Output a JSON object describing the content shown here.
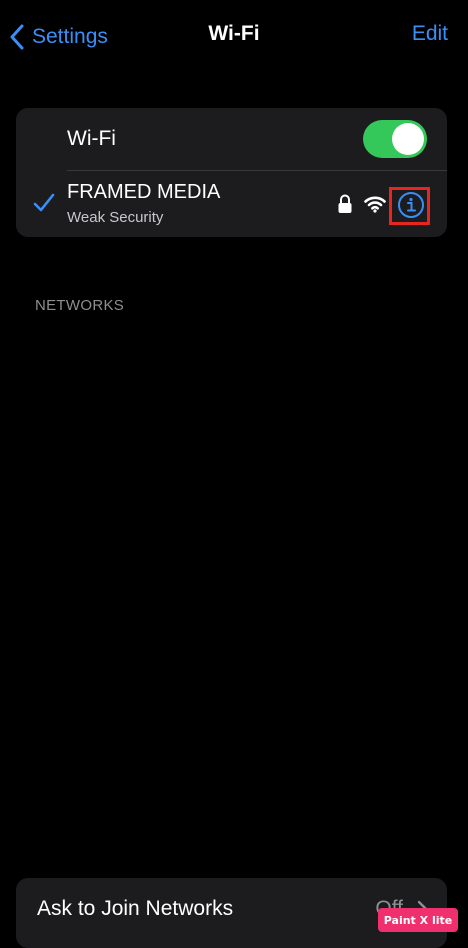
{
  "nav": {
    "back_label": "Settings",
    "title": "Wi-Fi",
    "edit_label": "Edit"
  },
  "wifi_toggle": {
    "label": "Wi-Fi",
    "enabled": true
  },
  "connected_network": {
    "name": "FRAMED MEDIA",
    "subtitle": "Weak Security",
    "icons": [
      "checkmark-icon",
      "lock-icon",
      "wifi-signal-icon",
      "info-icon"
    ]
  },
  "networks_section": {
    "header": "NETWORKS"
  },
  "ask_to_join": {
    "label": "Ask to Join Networks",
    "value": "Off"
  },
  "watermark": {
    "text": "Paint X lite"
  },
  "colors": {
    "accent": "#3a8ff7",
    "toggle_on": "#34c759",
    "highlight": "#e8261f",
    "background": "#000000",
    "card": "#1c1c1e"
  }
}
